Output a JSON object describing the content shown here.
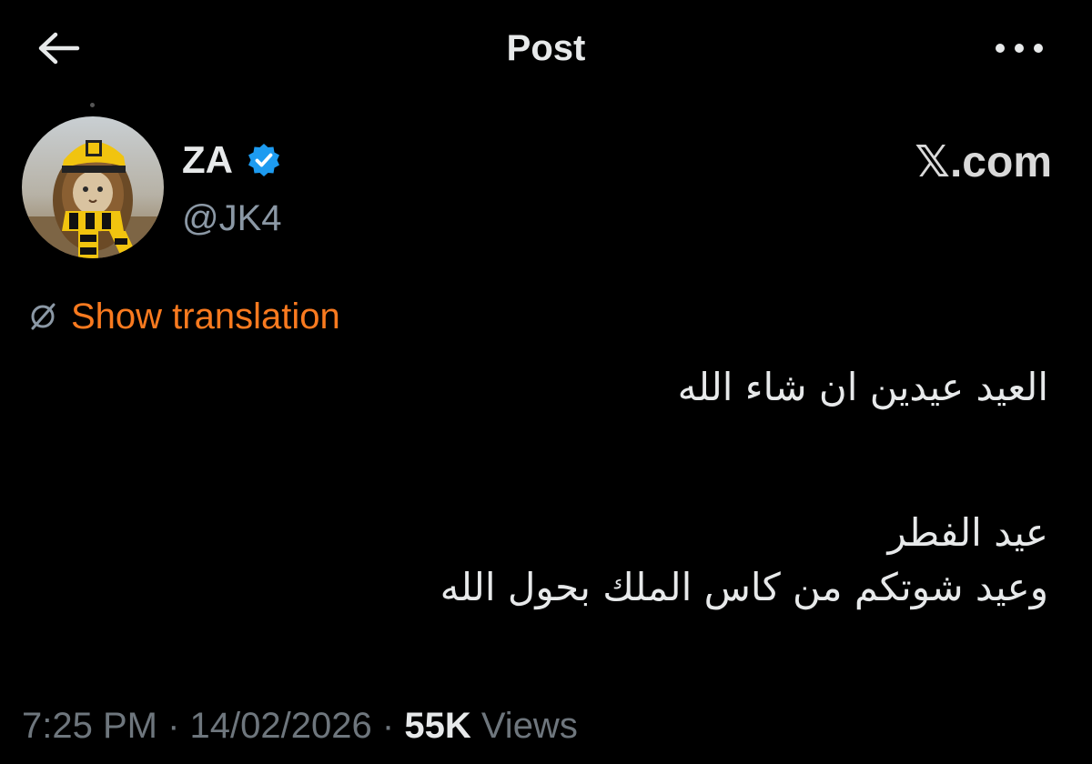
{
  "header": {
    "title": "Post",
    "back_icon": "arrow-left-icon",
    "more_icon": "more-horizontal-icon"
  },
  "author": {
    "name": "ZA",
    "handle": "@JK4",
    "verified": true,
    "verified_color": "#1d9bf0",
    "avatar": "avatar-lion-cat-yellow-scarf"
  },
  "watermark": {
    "brand": "𝕏",
    "suffix": ".com"
  },
  "translation": {
    "label": "Show translation",
    "icon": "globe-slash-icon",
    "color": "#f97a1f"
  },
  "tweet": {
    "lines": [
      "العيد عيدين ان شاء الله",
      "عيد الفطر",
      "وعيد شوتكم من كاس الملك بحول الله"
    ]
  },
  "meta": {
    "time": "7:25 PM",
    "separator": "·",
    "date": "14/02/2026",
    "views_count": "55K",
    "views_label": "Views"
  }
}
